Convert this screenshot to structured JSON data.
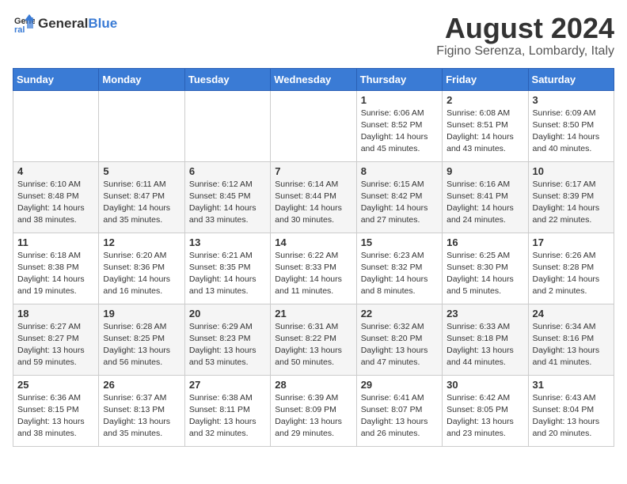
{
  "header": {
    "logo_general": "General",
    "logo_blue": "Blue",
    "month_title": "August 2024",
    "location": "Figino Serenza, Lombardy, Italy"
  },
  "weekdays": [
    "Sunday",
    "Monday",
    "Tuesday",
    "Wednesday",
    "Thursday",
    "Friday",
    "Saturday"
  ],
  "weeks": [
    [
      {
        "day": "",
        "info": ""
      },
      {
        "day": "",
        "info": ""
      },
      {
        "day": "",
        "info": ""
      },
      {
        "day": "",
        "info": ""
      },
      {
        "day": "1",
        "info": "Sunrise: 6:06 AM\nSunset: 8:52 PM\nDaylight: 14 hours\nand 45 minutes."
      },
      {
        "day": "2",
        "info": "Sunrise: 6:08 AM\nSunset: 8:51 PM\nDaylight: 14 hours\nand 43 minutes."
      },
      {
        "day": "3",
        "info": "Sunrise: 6:09 AM\nSunset: 8:50 PM\nDaylight: 14 hours\nand 40 minutes."
      }
    ],
    [
      {
        "day": "4",
        "info": "Sunrise: 6:10 AM\nSunset: 8:48 PM\nDaylight: 14 hours\nand 38 minutes."
      },
      {
        "day": "5",
        "info": "Sunrise: 6:11 AM\nSunset: 8:47 PM\nDaylight: 14 hours\nand 35 minutes."
      },
      {
        "day": "6",
        "info": "Sunrise: 6:12 AM\nSunset: 8:45 PM\nDaylight: 14 hours\nand 33 minutes."
      },
      {
        "day": "7",
        "info": "Sunrise: 6:14 AM\nSunset: 8:44 PM\nDaylight: 14 hours\nand 30 minutes."
      },
      {
        "day": "8",
        "info": "Sunrise: 6:15 AM\nSunset: 8:42 PM\nDaylight: 14 hours\nand 27 minutes."
      },
      {
        "day": "9",
        "info": "Sunrise: 6:16 AM\nSunset: 8:41 PM\nDaylight: 14 hours\nand 24 minutes."
      },
      {
        "day": "10",
        "info": "Sunrise: 6:17 AM\nSunset: 8:39 PM\nDaylight: 14 hours\nand 22 minutes."
      }
    ],
    [
      {
        "day": "11",
        "info": "Sunrise: 6:18 AM\nSunset: 8:38 PM\nDaylight: 14 hours\nand 19 minutes."
      },
      {
        "day": "12",
        "info": "Sunrise: 6:20 AM\nSunset: 8:36 PM\nDaylight: 14 hours\nand 16 minutes."
      },
      {
        "day": "13",
        "info": "Sunrise: 6:21 AM\nSunset: 8:35 PM\nDaylight: 14 hours\nand 13 minutes."
      },
      {
        "day": "14",
        "info": "Sunrise: 6:22 AM\nSunset: 8:33 PM\nDaylight: 14 hours\nand 11 minutes."
      },
      {
        "day": "15",
        "info": "Sunrise: 6:23 AM\nSunset: 8:32 PM\nDaylight: 14 hours\nand 8 minutes."
      },
      {
        "day": "16",
        "info": "Sunrise: 6:25 AM\nSunset: 8:30 PM\nDaylight: 14 hours\nand 5 minutes."
      },
      {
        "day": "17",
        "info": "Sunrise: 6:26 AM\nSunset: 8:28 PM\nDaylight: 14 hours\nand 2 minutes."
      }
    ],
    [
      {
        "day": "18",
        "info": "Sunrise: 6:27 AM\nSunset: 8:27 PM\nDaylight: 13 hours\nand 59 minutes."
      },
      {
        "day": "19",
        "info": "Sunrise: 6:28 AM\nSunset: 8:25 PM\nDaylight: 13 hours\nand 56 minutes."
      },
      {
        "day": "20",
        "info": "Sunrise: 6:29 AM\nSunset: 8:23 PM\nDaylight: 13 hours\nand 53 minutes."
      },
      {
        "day": "21",
        "info": "Sunrise: 6:31 AM\nSunset: 8:22 PM\nDaylight: 13 hours\nand 50 minutes."
      },
      {
        "day": "22",
        "info": "Sunrise: 6:32 AM\nSunset: 8:20 PM\nDaylight: 13 hours\nand 47 minutes."
      },
      {
        "day": "23",
        "info": "Sunrise: 6:33 AM\nSunset: 8:18 PM\nDaylight: 13 hours\nand 44 minutes."
      },
      {
        "day": "24",
        "info": "Sunrise: 6:34 AM\nSunset: 8:16 PM\nDaylight: 13 hours\nand 41 minutes."
      }
    ],
    [
      {
        "day": "25",
        "info": "Sunrise: 6:36 AM\nSunset: 8:15 PM\nDaylight: 13 hours\nand 38 minutes."
      },
      {
        "day": "26",
        "info": "Sunrise: 6:37 AM\nSunset: 8:13 PM\nDaylight: 13 hours\nand 35 minutes."
      },
      {
        "day": "27",
        "info": "Sunrise: 6:38 AM\nSunset: 8:11 PM\nDaylight: 13 hours\nand 32 minutes."
      },
      {
        "day": "28",
        "info": "Sunrise: 6:39 AM\nSunset: 8:09 PM\nDaylight: 13 hours\nand 29 minutes."
      },
      {
        "day": "29",
        "info": "Sunrise: 6:41 AM\nSunset: 8:07 PM\nDaylight: 13 hours\nand 26 minutes."
      },
      {
        "day": "30",
        "info": "Sunrise: 6:42 AM\nSunset: 8:05 PM\nDaylight: 13 hours\nand 23 minutes."
      },
      {
        "day": "31",
        "info": "Sunrise: 6:43 AM\nSunset: 8:04 PM\nDaylight: 13 hours\nand 20 minutes."
      }
    ]
  ]
}
